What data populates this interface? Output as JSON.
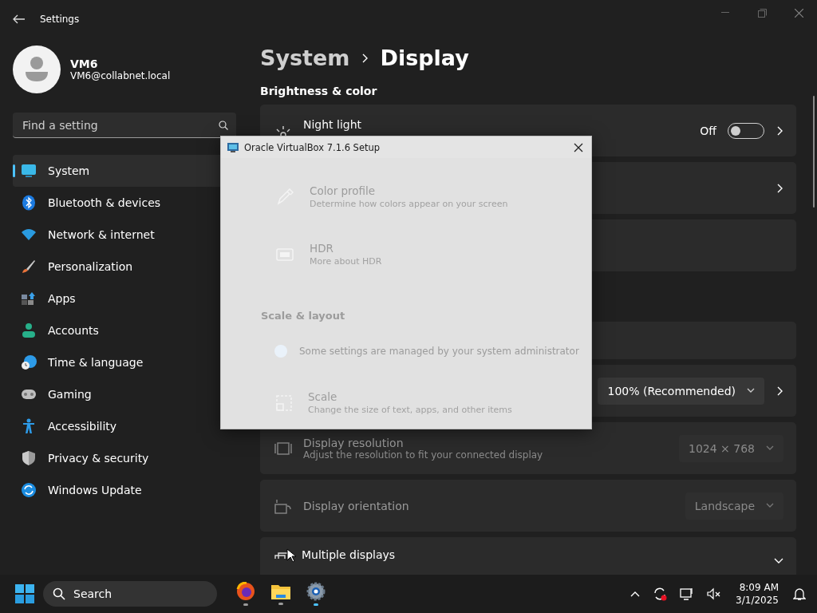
{
  "window": {
    "title": "Settings"
  },
  "profile": {
    "name": "VM6",
    "email": "VM6@collabnet.local"
  },
  "search": {
    "placeholder": "Find a setting"
  },
  "nav": [
    {
      "label": "System",
      "selected": true
    },
    {
      "label": "Bluetooth & devices",
      "selected": false
    },
    {
      "label": "Network & internet",
      "selected": false
    },
    {
      "label": "Personalization",
      "selected": false
    },
    {
      "label": "Apps",
      "selected": false
    },
    {
      "label": "Accounts",
      "selected": false
    },
    {
      "label": "Time & language",
      "selected": false
    },
    {
      "label": "Gaming",
      "selected": false
    },
    {
      "label": "Accessibility",
      "selected": false
    },
    {
      "label": "Privacy & security",
      "selected": false
    },
    {
      "label": "Windows Update",
      "selected": false
    }
  ],
  "breadcrumb": {
    "parent": "System",
    "current": "Display"
  },
  "section": "Brightness & color",
  "cards": [
    {
      "kind": "toggle",
      "title": "Night light",
      "state": "Off",
      "on": false
    },
    {
      "kind": "link"
    },
    {
      "kind": "blank"
    },
    {
      "kind": "notice",
      "break": true
    },
    {
      "kind": "dropdown",
      "value": "100% (Recommended)",
      "disabled": false
    },
    {
      "kind": "dropdown",
      "title": "Display resolution",
      "subtitle": "Adjust the resolution to fit your connected display",
      "value": "1024 × 768",
      "disabled": true
    },
    {
      "kind": "dropdown",
      "title": "Display orientation",
      "value": "Landscape",
      "disabled": true
    },
    {
      "kind": "expander",
      "title": "Multiple displays",
      "expanded": false
    }
  ],
  "dialog": {
    "title": "Oracle VirtualBox 7.1.6 Setup",
    "behind": [
      {
        "kind": "card",
        "title": "Color profile",
        "subtitle": "Determine how colors appear on your screen"
      },
      {
        "kind": "card",
        "title": "HDR",
        "subtitle": "More about HDR"
      },
      {
        "kind": "heading",
        "title": "Scale & layout"
      },
      {
        "kind": "notice",
        "title": "Some settings are managed by your system administrator"
      },
      {
        "kind": "card",
        "title": "Scale",
        "subtitle": "Change the size of text, apps, and other items"
      }
    ]
  },
  "taskbar": {
    "search": "Search",
    "time": "8:09 AM",
    "date": "3/1/2025"
  }
}
